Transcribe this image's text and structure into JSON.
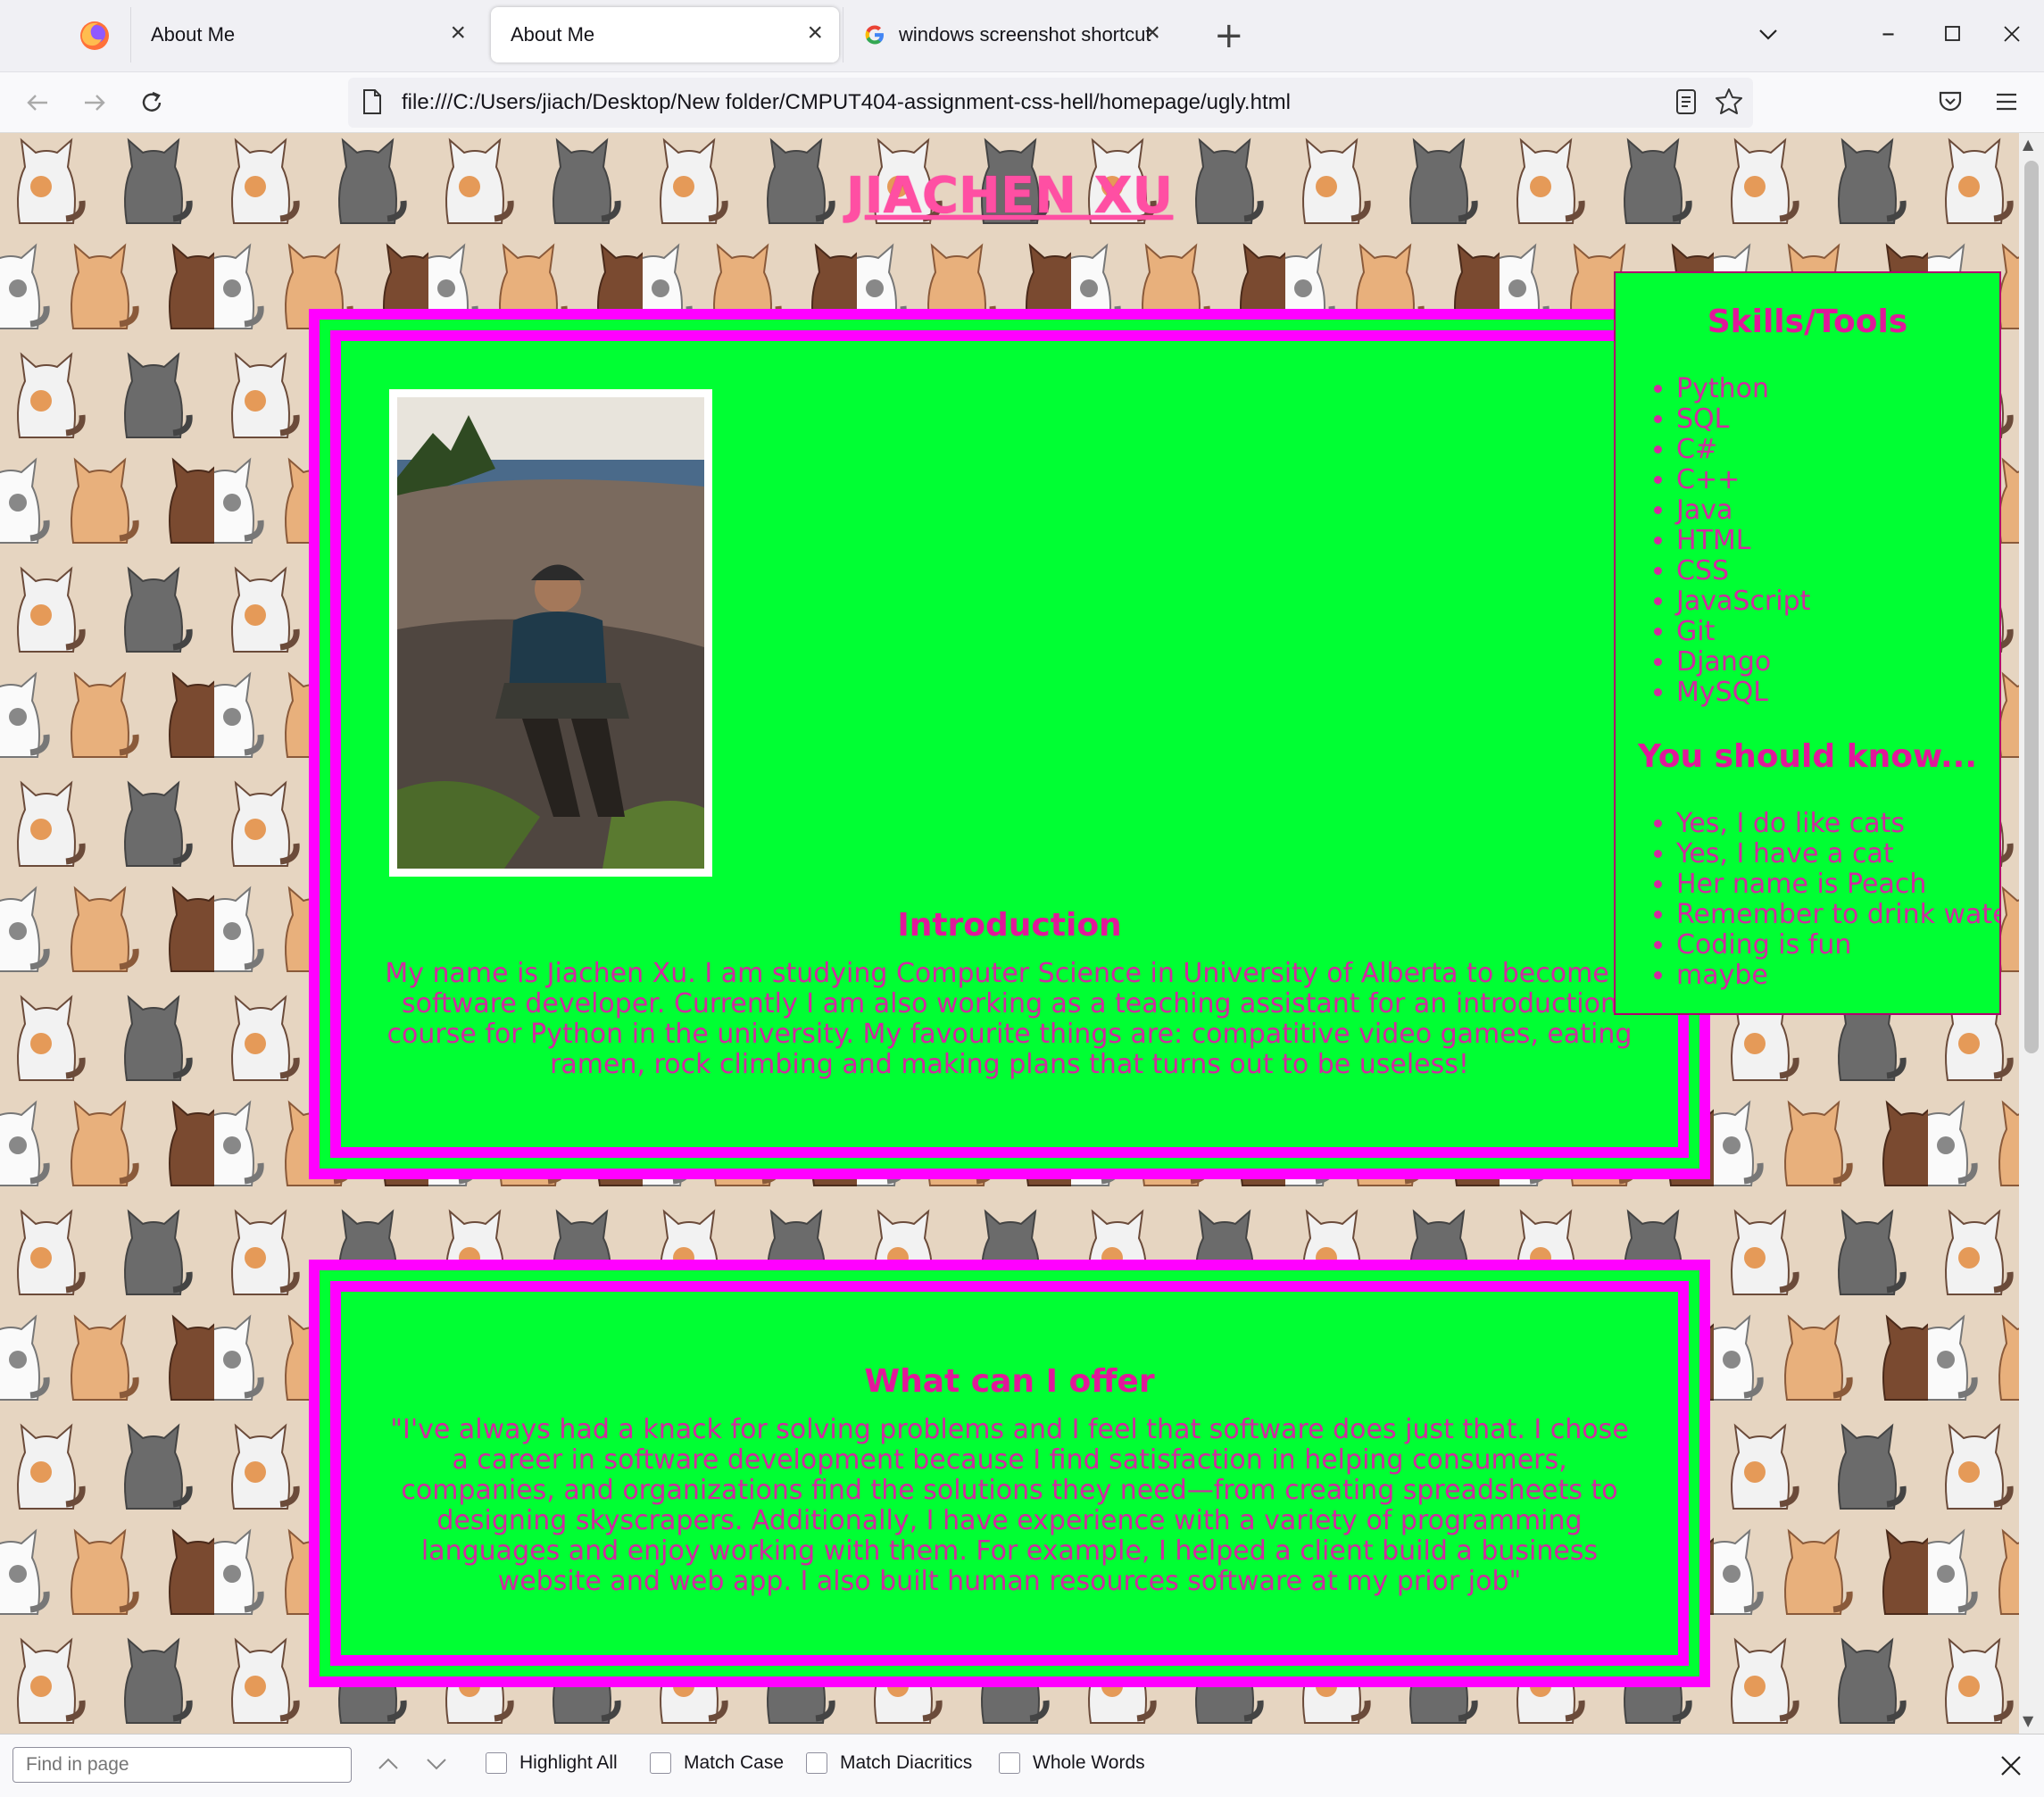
{
  "browser": {
    "tabs": [
      {
        "title": "About Me",
        "active": false
      },
      {
        "title": "About Me",
        "active": true
      },
      {
        "title": "windows screenshot shortcut - G",
        "active": false
      }
    ],
    "url": "file:///C:/Users/jiach/Desktop/New folder/CMPUT404-assignment-css-hell/homepage/ugly.html"
  },
  "page": {
    "title": "JIACHEN XU",
    "intro": {
      "heading": "Introduction",
      "text": "My name is Jiachen Xu. I am studying Computer Science in University of Alberta to become a software developer. Currently I am also working as a teaching assistant for an introduction course for Python in the university. My favourite things are: compatitive video games, eating ramen, rock climbing and making plans that turns out to be useless!"
    },
    "offer": {
      "heading": "What can I offer",
      "text": "\"I've always had a knack for solving problems and I feel that software does just that. I chose a career in software development because I find satisfaction in helping consumers, companies, and organizations find the solutions they need—from creating spreadsheets to designing skyscrapers. Additionally, I have experience with a variety of programming languages and enjoy working with them. For example, I helped a client build a business website and web app. I also built human resources software at my prior job\""
    },
    "skills": {
      "heading": "Skills/Tools",
      "items": [
        "Python",
        "SQL",
        "C#",
        "C++",
        "Java",
        "HTML",
        "CSS",
        "JavaScript",
        "Git",
        "Django",
        "MySQL"
      ]
    },
    "know": {
      "heading": "You should know...",
      "items": [
        "Yes, I do like cats",
        "Yes, I have a cat",
        "Her name is Peach",
        "Remember to drink water",
        "Coding is fun",
        "maybe"
      ]
    }
  },
  "findbar": {
    "placeholder": "Find in page",
    "options": [
      "Highlight All",
      "Match Case",
      "Match Diacritics",
      "Whole Words"
    ]
  },
  "colors": {
    "card_bg": "#00ff33",
    "card_border": "#ff00ff",
    "text_pink": "#d02aa0",
    "page_bg": "#e6d5c1"
  }
}
